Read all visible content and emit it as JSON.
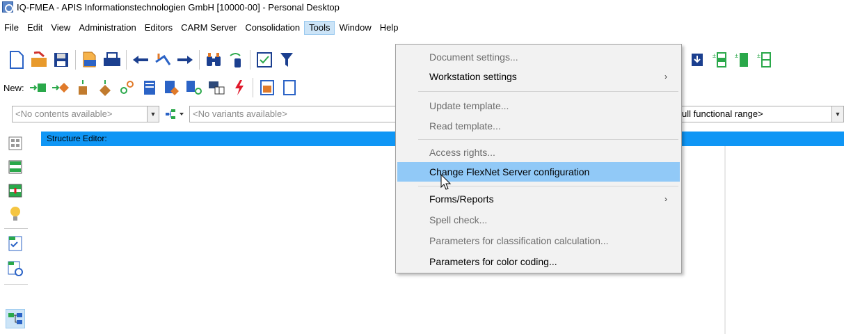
{
  "window": {
    "title": "IQ-FMEA - APIS Informationstechnologien GmbH [10000-00] - Personal Desktop"
  },
  "menubar": {
    "items": [
      "File",
      "Edit",
      "View",
      "Administration",
      "Editors",
      "CARM Server",
      "Consolidation",
      "Tools",
      "Window",
      "Help"
    ],
    "active": "Tools"
  },
  "toolbar2": {
    "new_label": "New:"
  },
  "combos": {
    "contents": "<No contents available>",
    "variants": "<No variants available>",
    "range": "ull functional range>"
  },
  "editor": {
    "header": "Structure Editor:"
  },
  "tools_menu": {
    "items": [
      {
        "label": "Document settings...",
        "enabled": false,
        "submenu": false
      },
      {
        "label": "Workstation settings",
        "enabled": true,
        "submenu": true
      },
      {
        "label": "Update template...",
        "enabled": false,
        "submenu": false
      },
      {
        "label": "Read template...",
        "enabled": false,
        "submenu": false
      },
      {
        "label": "Access rights...",
        "enabled": false,
        "submenu": false
      },
      {
        "label": "Change FlexNet Server configuration",
        "enabled": true,
        "submenu": false,
        "highlighted": true
      },
      {
        "label": "Forms/Reports",
        "enabled": true,
        "submenu": true
      },
      {
        "label": "Spell check...",
        "enabled": false,
        "submenu": false
      },
      {
        "label": "Parameters for classification calculation...",
        "enabled": false,
        "submenu": false
      },
      {
        "label": "Parameters for color coding...",
        "enabled": true,
        "submenu": false
      }
    ],
    "submenu_arrow": "›"
  },
  "colors": {
    "editor_header": "#0f96f5",
    "menu_highlight": "#91c9f7",
    "menu_bg": "#f2f2f2",
    "accent_green": "#2aa84a",
    "accent_orange": "#e07a2a",
    "accent_blue": "#2b63c6"
  }
}
